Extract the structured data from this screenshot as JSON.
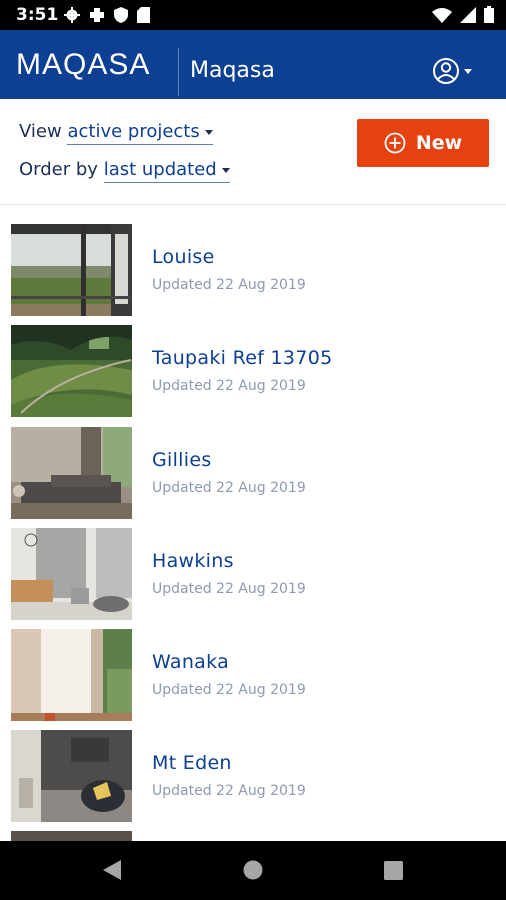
{
  "status_bar": {
    "time": "3:51",
    "icons_left": [
      "settings-icon",
      "medical-icon",
      "shield-icon",
      "sd-card-icon"
    ],
    "icons_right": [
      "wifi-icon",
      "cellular-signal-icon",
      "battery-icon"
    ]
  },
  "app_bar": {
    "brand": "MAQASA",
    "organization": "Maqasa",
    "account_icon": "account-circle-icon",
    "colors": {
      "background": "#0d3f92"
    }
  },
  "controls": {
    "view_prefix": "View",
    "view_value": "active projects",
    "order_prefix": "Order by",
    "order_value": "last updated",
    "new_button": "New",
    "new_button_color": "#e6420f"
  },
  "projects": [
    {
      "name": "Louise",
      "updated": "Updated 22 Aug 2019",
      "thumb": "deck-view"
    },
    {
      "name": "Taupaki Ref 13705",
      "updated": "Updated 22 Aug 2019",
      "thumb": "aerial-view"
    },
    {
      "name": "Gillies",
      "updated": "Updated 22 Aug 2019",
      "thumb": "living-room"
    },
    {
      "name": "Hawkins",
      "updated": "Updated 22 Aug 2019",
      "thumb": "curtained-room"
    },
    {
      "name": "Wanaka",
      "updated": "Updated 22 Aug 2019",
      "thumb": "sheer-curtains"
    },
    {
      "name": "Mt Eden",
      "updated": "Updated 22 Aug 2019",
      "thumb": "chair-corner"
    }
  ],
  "nav_bar": {
    "buttons": [
      "back-icon",
      "home-icon",
      "recents-icon"
    ]
  }
}
